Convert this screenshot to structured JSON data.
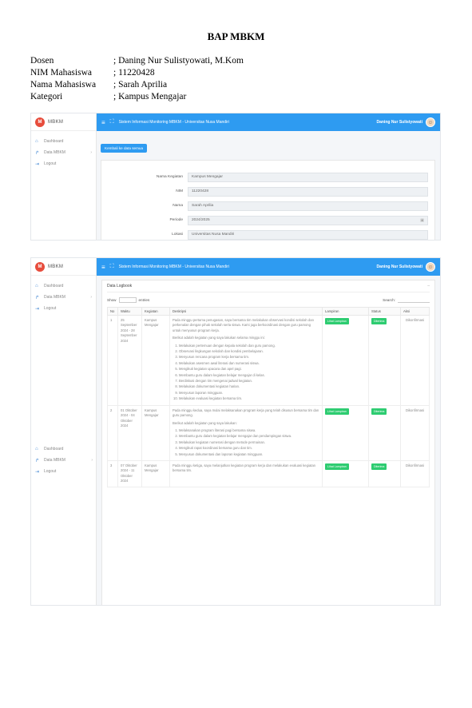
{
  "document": {
    "title": "BAP MBKM",
    "meta": [
      {
        "key": "Dosen",
        "value": "; Daning Nur Sulistyowati, M.Kom"
      },
      {
        "key": "NIM Mahasiswa",
        "value": "; 11220428"
      },
      {
        "key": "Nama Mahasiswa",
        "value": "; Sarah Aprilia"
      },
      {
        "key": "Kategori",
        "value": "; Kampus Mengajar"
      }
    ]
  },
  "app": {
    "brand": "MBKM",
    "brand_logo": "M",
    "topbar_text": "Sistem Informasi Monitoring MBKM - Universitas Nusa Mandiri",
    "user_name": "Daning Nur Sulistyowati",
    "sidebar": [
      "Dashboard",
      "Data MBKM",
      "Logout"
    ]
  },
  "shot1": {
    "back_button": "Kembali ke data semua",
    "fields": [
      {
        "label": "Nama Kegiatan",
        "value": "Kampus Mengajar"
      },
      {
        "label": "NIM",
        "value": "11220428"
      },
      {
        "label": "Nama",
        "value": "Sarah Aprilia"
      },
      {
        "label": "Periode",
        "value": "2024/2025"
      },
      {
        "label": "Lokasi",
        "value": "Universitas Nusa Mandiri"
      }
    ]
  },
  "shot2": {
    "card_title": "Data Logbook",
    "show_label": "Show",
    "entries_label": "entries",
    "search_label": "Search:",
    "columns": [
      "No",
      "Waktu",
      "Kegiatan",
      "Deskripsi",
      "Lampiran",
      "Status",
      "Aksi"
    ],
    "rows": [
      {
        "no": "1",
        "waktu": "25 September 2024 - 28 September 2024",
        "kegiatan": "Kampus Mengajar",
        "desc_paras": [
          "Pada minggu pertama penugasan, saya bersama tim melakukan observasi kondisi sekolah dan perkenalan dengan pihak sekolah serta siswa. Kami juga berkoordinasi dengan guru pamong untuk menyusun program kerja.",
          "Berikut adalah kegiatan yang saya lakukan selama minggu ini:"
        ],
        "desc_items": [
          "Melakukan pertemuan dengan kepala sekolah dan guru pamong.",
          "Observasi lingkungan sekolah dan kondisi pembelajaran.",
          "Menyusun rencana program kerja bersama tim.",
          "Melakukan asesmen awal literasi dan numerasi siswa.",
          "Mengikuti kegiatan upacara dan apel pagi.",
          "Membantu guru dalam kegiatan belajar mengajar di kelas.",
          "Berdiskusi dengan tim mengenai jadwal kegiatan.",
          "Melakukan dokumentasi kegiatan harian.",
          "Menyusun laporan mingguan.",
          "Melakukan evaluasi kegiatan bersama tim."
        ],
        "lampiran": "Lihat Lampiran",
        "status": "Diterima",
        "aksi": "Dikonfirmasi"
      },
      {
        "no": "2",
        "waktu": "01 Oktober 2024 - 04 Oktober 2024",
        "kegiatan": "Kampus Mengajar",
        "desc_paras": [
          "Pada minggu kedua, saya mulai melaksanakan program kerja yang telah disusun bersama tim dan guru pamong.",
          "Berikut adalah kegiatan yang saya lakukan:"
        ],
        "desc_items": [
          "Melaksanakan program literasi pagi bersama siswa.",
          "Membantu guru dalam kegiatan belajar mengajar dan pendampingan siswa.",
          "Melakukan kegiatan numerasi dengan metode permainan.",
          "Mengikuti rapat koordinasi bersama guru dan tim.",
          "Menyusun dokumentasi dan laporan kegiatan mingguan."
        ],
        "lampiran": "Lihat Lampiran",
        "status": "Diterima",
        "aksi": "Dikonfirmasi"
      },
      {
        "no": "3",
        "waktu": "07 Oktober 2024 - 11 Oktober 2024",
        "kegiatan": "Kampus Mengajar",
        "desc_paras": [
          "Pada minggu ketiga, saya melanjutkan kegiatan program kerja dan melakukan evaluasi kegiatan bersama tim."
        ],
        "desc_items": [],
        "lampiran": "Lihat Lampiran",
        "status": "Diterima",
        "aksi": "Dikonfirmasi"
      }
    ]
  },
  "colors": {
    "topbar": "#2e9bf1",
    "success": "#2ecc71",
    "danger": "#e74c3c"
  }
}
